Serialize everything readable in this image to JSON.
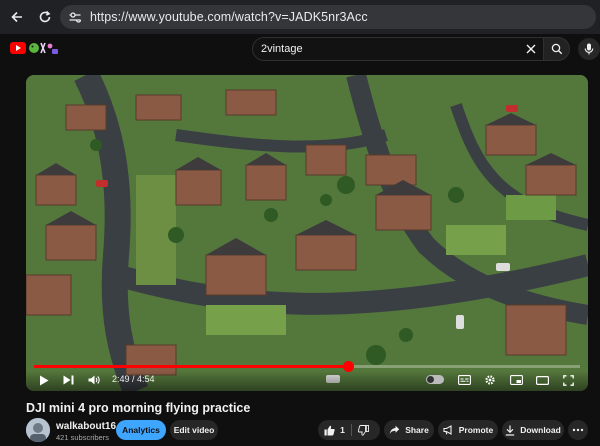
{
  "browser": {
    "url": "https://www.youtube.com/watch?v=JADK5nr3Acc"
  },
  "header": {
    "search_value": "2vintage"
  },
  "player": {
    "current_time": "2:49",
    "duration": "4:54",
    "time_display": "2:49 / 4:54",
    "progress_fraction": 0.575
  },
  "video": {
    "title": "DJI mini 4 pro morning flying practice"
  },
  "channel": {
    "name": "walkabout16",
    "subscribers": "421 subscribers"
  },
  "actions": {
    "analytics_label": "Analytics",
    "edit_label": "Edit video",
    "like_count": "1",
    "share_label": "Share",
    "promote_label": "Promote",
    "download_label": "Download"
  },
  "colors": {
    "accent_red": "#ff0000",
    "analytics_blue": "#3ea6ff",
    "page_bg": "#0f0f0f"
  }
}
